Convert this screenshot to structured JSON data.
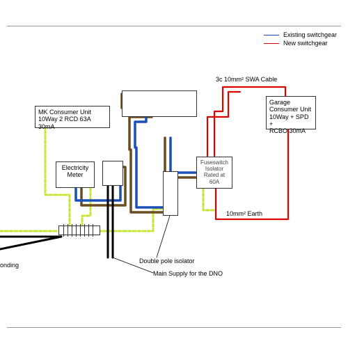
{
  "legend": {
    "existing": "Existing switchgear",
    "new": "New switchgear"
  },
  "boxes": {
    "consumer_unit": "MK Consumer Unit\n10Way 2 RCD 63A 30mA",
    "meter": "Electricity\nMeter",
    "fuse_switch": "Fuseswitch\nIsolator\nRated at 60A",
    "garage_unit": "Garage\nConsumer Unit\n10Way  + SPD +\nRCBO 30mA"
  },
  "labels": {
    "swa_cable": "3c 10mm² SWA Cable",
    "earth_10": "10mm² Earth",
    "double_pole": "Double pole isolator",
    "main_supply": "Main Supply for the DNO",
    "bonding": "onding"
  },
  "colors": {
    "existing": "#1a4fb8",
    "new": "#d00",
    "brown": "#6c4b1f",
    "earth": "#c6e63a",
    "black": "#000"
  }
}
